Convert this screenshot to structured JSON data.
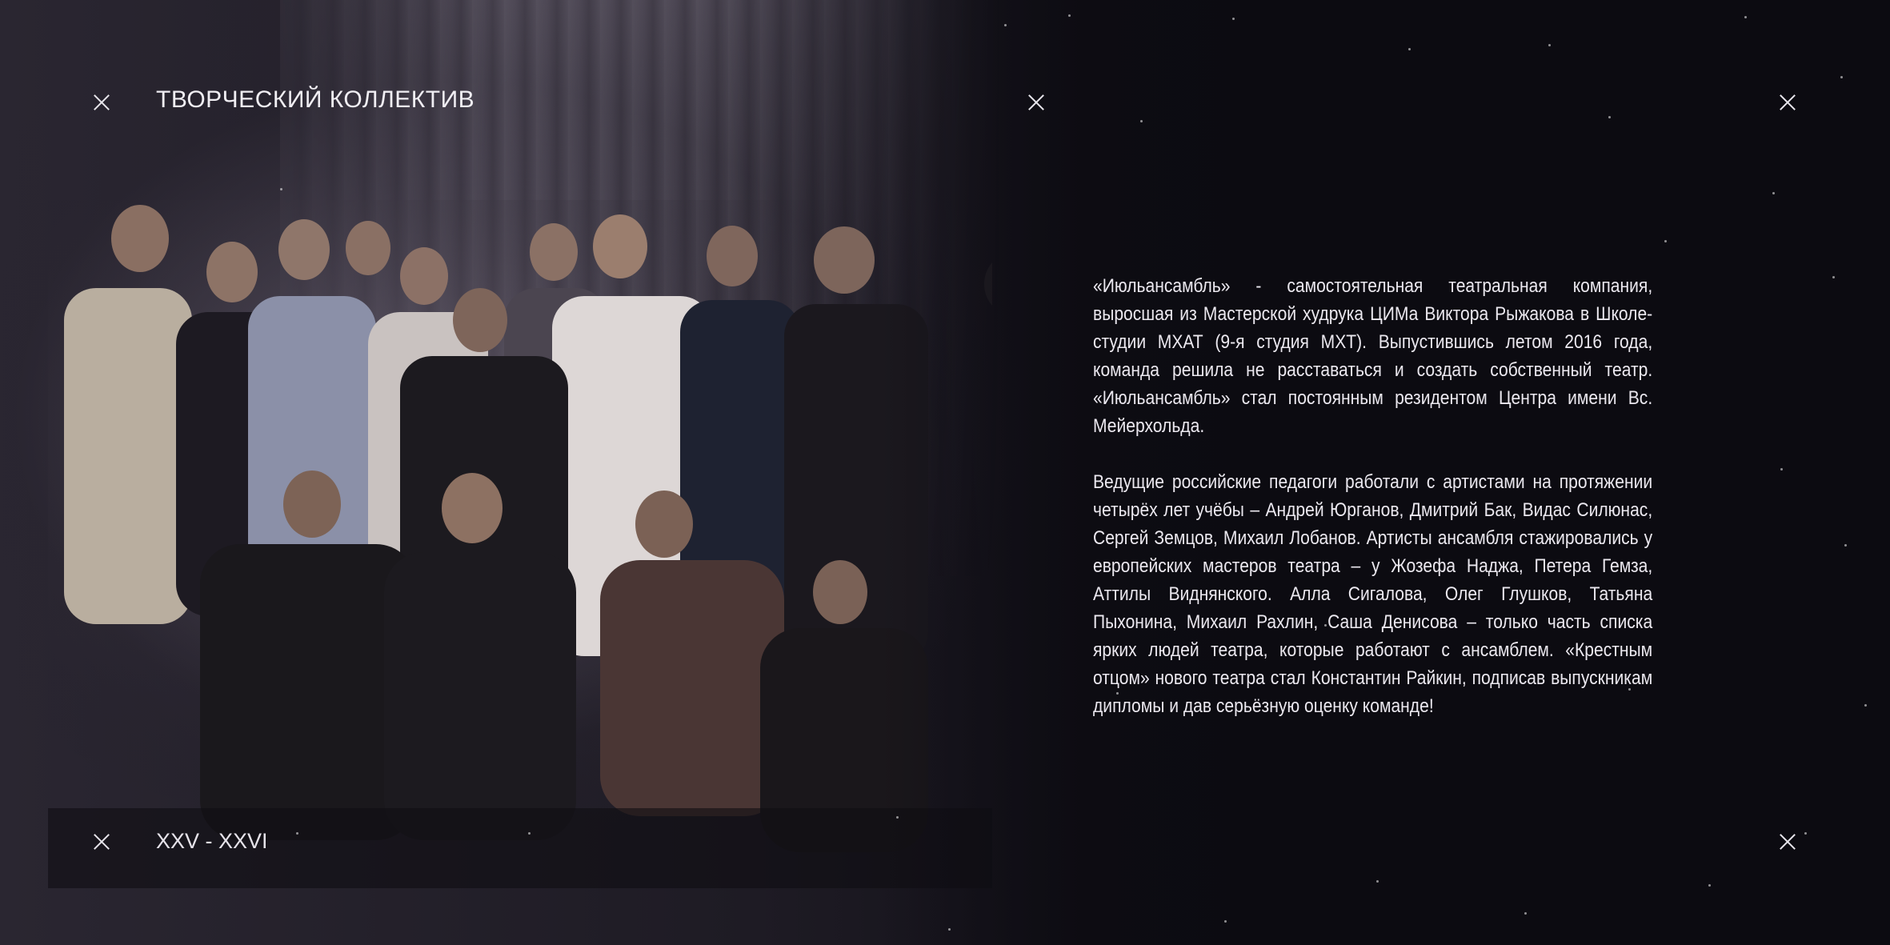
{
  "header": {
    "section_title": "ТВОРЧЕСКИЙ КОЛЛЕКТИВ"
  },
  "footer": {
    "page_numbers": "XXV - XXVI"
  },
  "body": {
    "paragraphs": [
      "«Июльансамбль» - самостоятельная театральная компания, выросшая из Мастерской худрука ЦИМа Виктора Рыжакова в Школе-студии МХАТ (9-я студия МХТ). Выпустившись летом 2016 года, команда решила не расставаться и создать собственный театр. «Июльансамбль» стал постоянным резидентом Центра имени Вс. Мейерхольда.",
      "Ведущие российские педагоги работали с артистами на протяжении четырёх лет учёбы – Андрей Юрганов, Дмитрий Бак, Видас Силюнас, Сергей Земцов, Михаил Лобанов.  Артисты ансамбля стажировались у европейских мастеров театра – у Жозефа Наджа, Петера Гемза, Аттилы Виднянского.  Алла Сигалова, Олег Глушков, Татьяна Пыхонина, Михаил Рахлин, Саша Денисова – только часть списка ярких людей театра, которые работают с ансамблем.  «Крестным отцом» нового театра стал Константин Райкин, подписав выпускникам дипломы и дав серьёзную оценку команде!"
    ]
  },
  "icons": {
    "crop_mark": "close-x-icon"
  },
  "colors": {
    "background": "#0c0b11",
    "text": "#ebe8ef"
  }
}
